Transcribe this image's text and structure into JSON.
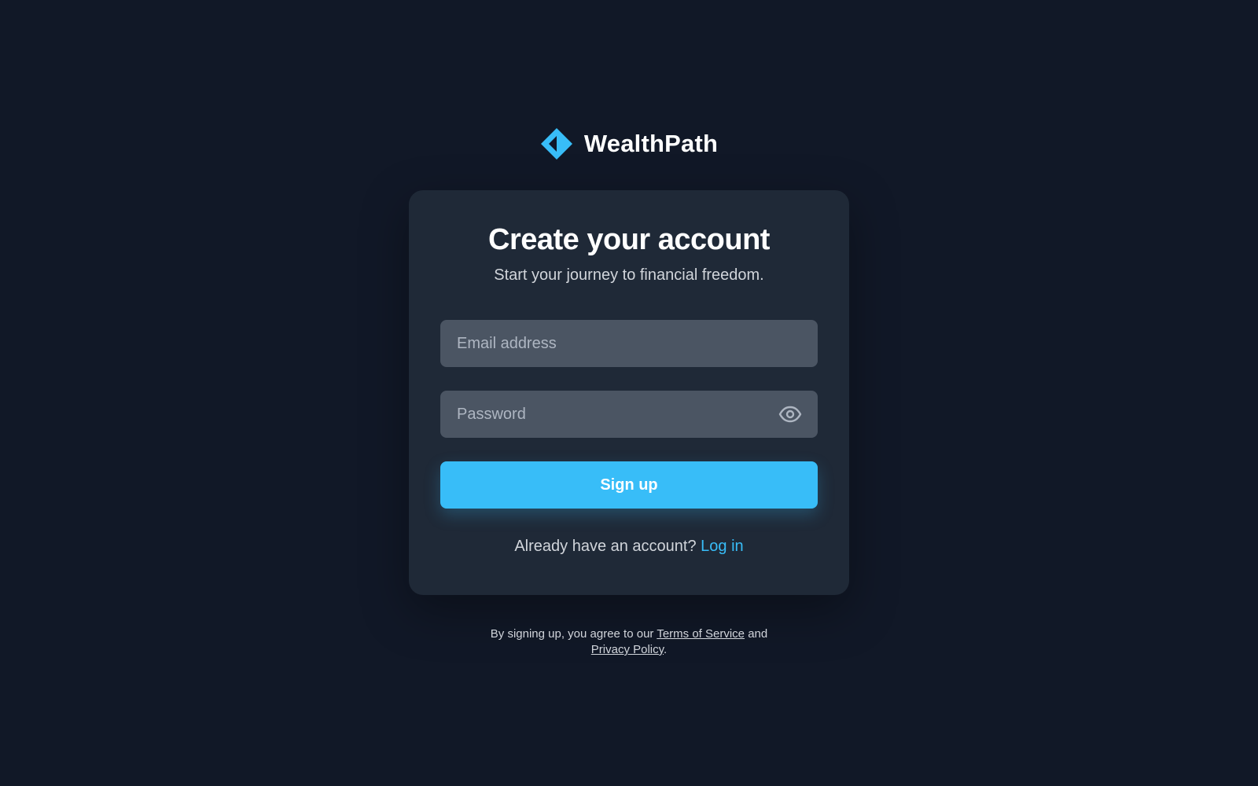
{
  "brand": {
    "name": "WealthPath",
    "logo_icon": "diamond-logo-icon",
    "accent_color": "#38bdf8"
  },
  "card": {
    "title": "Create your account",
    "subtitle": "Start your journey to financial freedom."
  },
  "form": {
    "email_placeholder": "Email address",
    "password_placeholder": "Password",
    "password_toggle_icon": "eye-icon",
    "submit_label": "Sign up"
  },
  "login": {
    "prompt": "Already have an account?",
    "link_label": "Log in"
  },
  "legal": {
    "prefix": "By signing up, you agree to our",
    "terms_label": "Terms of Service",
    "conjunction": "and",
    "privacy_label": "Privacy Policy",
    "suffix": "."
  },
  "colors": {
    "background": "#111827",
    "card": "#1f2937",
    "input": "#4b5563",
    "primary": "#38bdf8"
  }
}
